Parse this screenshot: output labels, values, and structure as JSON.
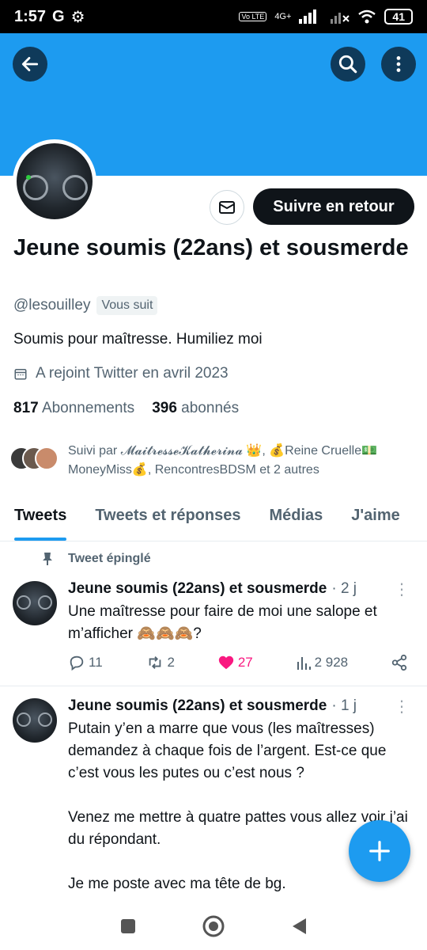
{
  "status_bar": {
    "time": "1:57",
    "carrier_letter": "G",
    "network": "4G+",
    "battery": "41"
  },
  "profile": {
    "display_name": "Jeune soumis (22ans) et sousmerde",
    "handle": "@lesouilley",
    "follows_you_badge": "Vous suit",
    "follow_button": "Suivre en retour",
    "bio": "Soumis pour maîtresse. Humiliez moi",
    "joined": "A rejoint Twitter en avril 2023",
    "following_count": "817",
    "following_label": "Abonnements",
    "followers_count": "396",
    "followers_label": "abonnés",
    "followed_by_line1": "Suivi par 𝓜𝓪𝓲𝓽𝓻𝓮𝓼𝓼𝓮𝓚𝓪𝓽𝓱𝓮𝓻𝓲𝓷𝓪 👑, 💰Reine Cruelle💵",
    "followed_by_line2": "MoneyMiss💰, RencontresBDSM et 2 autres"
  },
  "tabs": [
    "Tweets",
    "Tweets et réponses",
    "Médias",
    "J'aime"
  ],
  "pinned_label": "Tweet épinglé",
  "tweets": [
    {
      "name": "Jeune soumis (22ans) et sousmerde",
      "time": "· 2 j",
      "text": "Une maîtresse pour faire de moi une salope et m’afficher 🙈🙈🙈?",
      "replies": "11",
      "retweets": "2",
      "likes": "27",
      "views": "2 928"
    },
    {
      "name": "Jeune soumis (22ans) et sousmerde",
      "time": "· 1 j",
      "text": "Putain y’en a marre que vous (les maîtresses) demandez à chaque fois de l’argent. Est-ce que c’est vous les putes ou c’est nous ?\n\nVenez me mettre à quatre pattes vous allez voir j’ai du répondant.\n\nJe me poste avec ma tête de bg."
    }
  ],
  "colors": {
    "accent": "#1d9bf0",
    "like": "#f91880",
    "text": "#0f1419",
    "muted": "#536471"
  }
}
